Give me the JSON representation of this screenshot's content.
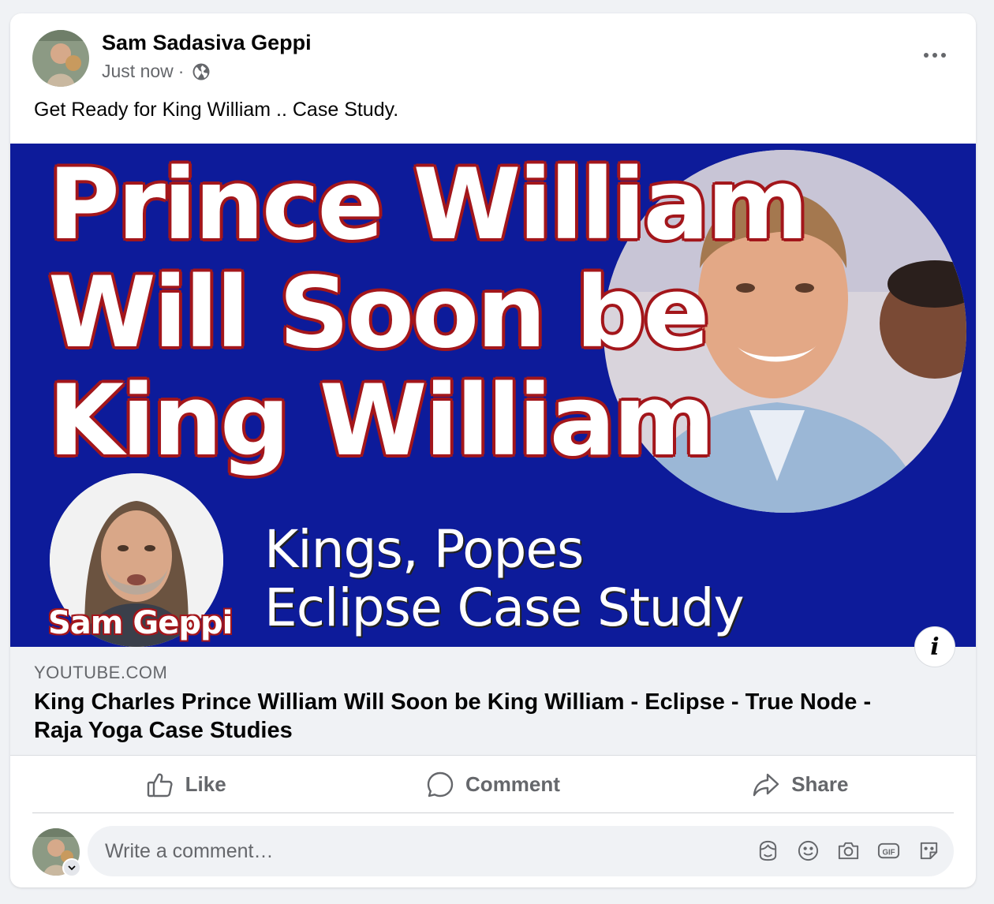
{
  "post": {
    "author": "Sam Sadasiva Geppi",
    "timestamp": "Just now",
    "separator": "·",
    "audience_icon": "globe-icon",
    "text": "Get Ready for King William .. Case Study."
  },
  "link_preview": {
    "image": {
      "headline_line1": "Prince William",
      "headline_line2": "Will Soon be",
      "headline_line3": "King William",
      "subtitle_line1": "Kings, Popes",
      "subtitle_line2": "Eclipse Case Study",
      "presenter_label": "Sam Geppi",
      "background_color": "#0d1b9a",
      "outline_color": "#a3161b"
    },
    "domain": "YOUTUBE.COM",
    "title": "King Charles Prince William Will Soon be King William - Eclipse - True Node - Raja Yoga Case Studies",
    "info_icon_label": "i"
  },
  "actions": [
    {
      "label": "Like",
      "icon": "thumbs-up-icon"
    },
    {
      "label": "Comment",
      "icon": "speech-bubble-icon"
    },
    {
      "label": "Share",
      "icon": "share-arrow-icon"
    }
  ],
  "composer": {
    "placeholder": "Write a comment…",
    "icons": [
      "avatar-sticker-icon",
      "emoji-icon",
      "camera-icon",
      "gif-icon",
      "sticker-icon"
    ]
  }
}
